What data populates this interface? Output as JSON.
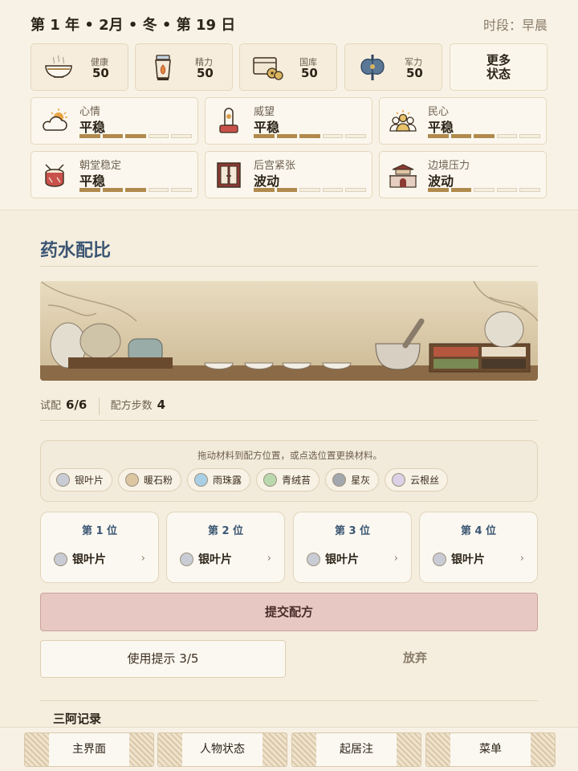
{
  "header": {
    "date": "第 1 年 • 2月 • 冬 • 第 19 日",
    "period": "时段：早晨"
  },
  "resources": [
    {
      "label": "健康",
      "value": "50",
      "icon": "bowl-icon"
    },
    {
      "label": "精力",
      "value": "50",
      "icon": "lantern-icon"
    },
    {
      "label": "国库",
      "value": "50",
      "icon": "treasury-icon"
    },
    {
      "label": "军力",
      "value": "50",
      "icon": "halberd-icon"
    }
  ],
  "more_status": "更多\n状态",
  "statuses": [
    {
      "label": "心情",
      "value": "平稳",
      "level": 3,
      "max": 5,
      "icon": "weather-icon"
    },
    {
      "label": "威望",
      "value": "平稳",
      "level": 3,
      "max": 5,
      "icon": "seal-icon"
    },
    {
      "label": "民心",
      "value": "平稳",
      "level": 3,
      "max": 5,
      "icon": "people-icon"
    },
    {
      "label": "朝堂稳定",
      "value": "平稳",
      "level": 3,
      "max": 5,
      "icon": "drum-icon"
    },
    {
      "label": "后宫紧张",
      "value": "波动",
      "level": 2,
      "max": 5,
      "icon": "door-icon"
    },
    {
      "label": "边境压力",
      "value": "波动",
      "level": 2,
      "max": 5,
      "icon": "fortress-icon"
    }
  ],
  "panel": {
    "title": "药水配比",
    "trial_label": "试配",
    "trial_value": "6/6",
    "steps_label": "配方步数",
    "steps_value": "4",
    "materials_hint": "拖动材料到配方位置，或点选位置更换材料。",
    "materials": [
      {
        "name": "银叶片",
        "color": "#c9ccd4"
      },
      {
        "name": "暖石粉",
        "color": "#dcc6a1"
      },
      {
        "name": "雨珠露",
        "color": "#a9cfe6"
      },
      {
        "name": "青绒苔",
        "color": "#b9d8ae"
      },
      {
        "name": "星灰",
        "color": "#a3a7ae"
      },
      {
        "name": "云根丝",
        "color": "#dcd0e6"
      }
    ],
    "slots": [
      {
        "label": "第 1 位",
        "material": "银叶片"
      },
      {
        "label": "第 2 位",
        "material": "银叶片"
      },
      {
        "label": "第 3 位",
        "material": "银叶片"
      },
      {
        "label": "第 4 位",
        "material": "银叶片"
      }
    ],
    "submit": "提交配方",
    "hint_button": "使用提示 3/5",
    "give_up": "放弃",
    "next_section_partial": "三阿记录"
  },
  "nav": [
    "主界面",
    "人物状态",
    "起居注",
    "菜单"
  ],
  "colors": {
    "accent": "#3b5673",
    "submit_bg": "#e8c8c3",
    "bar_on": "#b08a4c"
  }
}
